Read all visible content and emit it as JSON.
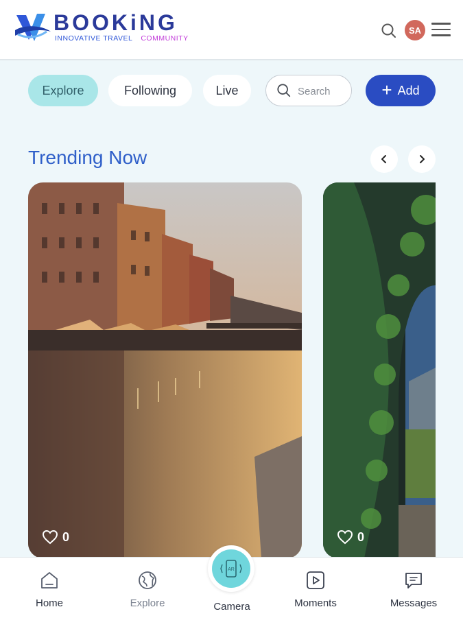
{
  "brand": {
    "name": "BOOKiNG",
    "tagline_left": "INNOVATIVE TRAVEL",
    "tagline_right": "COMMUNITY",
    "primary_color": "#2b3a9a",
    "accent_color": "#c13ad9"
  },
  "header": {
    "search_icon": "search-icon",
    "avatar_initials": "SA",
    "avatar_color": "#d1685c",
    "menu_icon": "hamburger-icon"
  },
  "filters": {
    "tabs": [
      {
        "label": "Explore",
        "active": true
      },
      {
        "label": "Following",
        "active": false
      },
      {
        "label": "Live",
        "active": false
      }
    ],
    "search_placeholder": "Search",
    "add_label": "Add"
  },
  "trending": {
    "title": "Trending Now",
    "prev_icon": "chevron-left-icon",
    "next_icon": "chevron-right-icon",
    "cards": [
      {
        "likes": "0",
        "scene": "canal-at-sunset"
      },
      {
        "likes": "0",
        "scene": "green-archway"
      }
    ]
  },
  "bottom_nav": {
    "items": [
      {
        "label": "Home",
        "icon": "home-icon"
      },
      {
        "label": "Explore",
        "icon": "globe-icon"
      },
      {
        "label": "Camera",
        "icon": "camera-ar-icon"
      },
      {
        "label": "Moments",
        "icon": "play-icon"
      },
      {
        "label": "Messages",
        "icon": "message-icon"
      }
    ]
  }
}
